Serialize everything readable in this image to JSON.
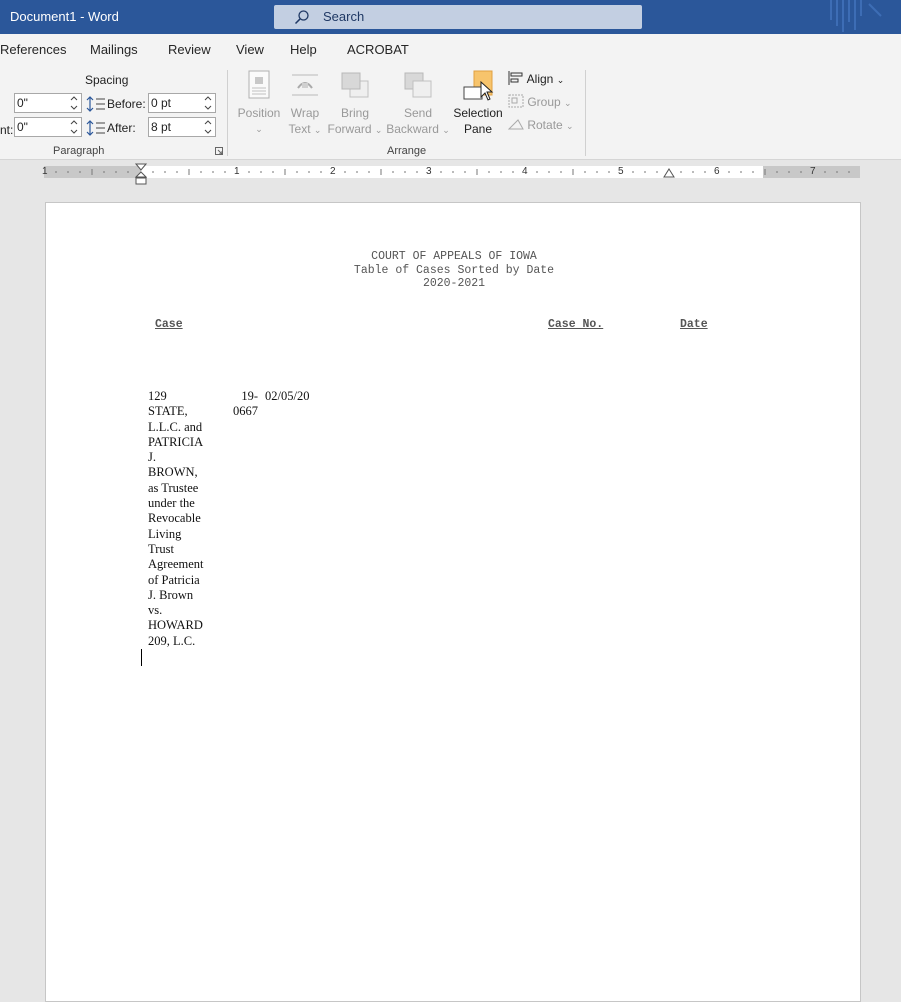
{
  "window": {
    "doc_title": "Document1  -  Word",
    "search_placeholder": "Search"
  },
  "tabs": [
    "References",
    "Mailings",
    "Review",
    "View",
    "Help",
    "ACROBAT"
  ],
  "ribbon": {
    "paragraph": {
      "spacing_heading": "Spacing",
      "indent_left_value": "0\"",
      "indent_right_label": "nt:",
      "indent_right_value": "0\"",
      "before_label": "Before:",
      "before_value": "0 pt",
      "after_label": "After:",
      "after_value": "8 pt",
      "group_label": "Paragraph"
    },
    "arrange": {
      "position": [
        "Position",
        ""
      ],
      "wrap_text": [
        "Wrap",
        "Text"
      ],
      "bring_forward": [
        "Bring",
        "Forward"
      ],
      "send_backward": [
        "Send",
        "Backward"
      ],
      "selection_pane": [
        "Selection",
        "Pane"
      ],
      "align": "Align",
      "group": "Group",
      "rotate": "Rotate",
      "group_label": "Arrange"
    }
  },
  "ruler": {
    "numbers": [
      "1",
      "1",
      "2",
      "3",
      "4",
      "5",
      "6",
      "7"
    ]
  },
  "document": {
    "header": {
      "line1": "COURT OF APPEALS OF IOWA",
      "line2": "Table of Cases Sorted by Date",
      "line3": "2020-2021"
    },
    "columns": {
      "case": "Case",
      "case_no": "Case No.",
      "date": "Date"
    },
    "rows": [
      {
        "case_lines": [
          "129",
          "STATE,",
          "L.L.C. and",
          "PATRICIA",
          "J.",
          "BROWN,",
          "as Trustee",
          "under the",
          "Revocable",
          "Living",
          "Trust",
          "Agreement",
          "of Patricia",
          "J. Brown",
          "vs.",
          "HOWARD",
          "209, L.C."
        ],
        "case_no_lines": [
          "19-",
          "0667"
        ],
        "date": "02/05/20"
      }
    ]
  },
  "colors": {
    "title_bar": "#2b579a",
    "ribbon_bg": "#f3f3f3",
    "workspace_bg": "#e6e6e6",
    "selection_pane_icon": "#f7c46c"
  }
}
